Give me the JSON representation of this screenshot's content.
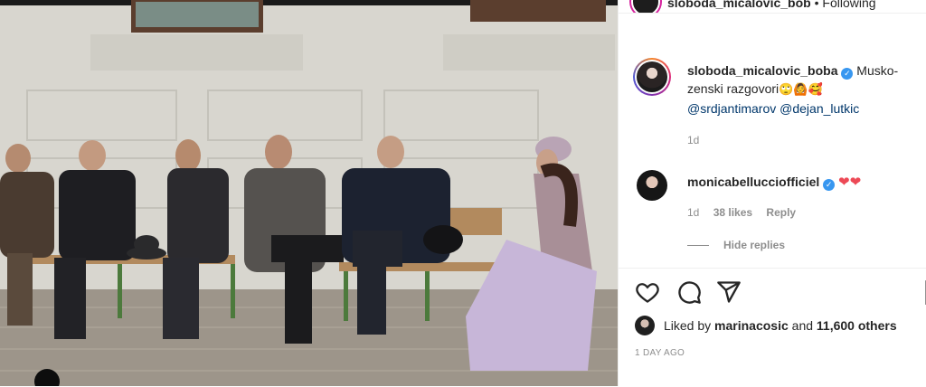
{
  "header": {
    "username": "sloboda_micalovic_bob",
    "separator": "•",
    "follow_state": "Following"
  },
  "caption": {
    "username": "sloboda_micalovic_boba",
    "text": "Musko-zenski razgovori",
    "emojis": "🙄🙆🥰",
    "mention1": "@srdjantimarov",
    "mention2": "@dejan_lutkic",
    "time": "1d"
  },
  "comment": {
    "username": "monicabellucciofficiel",
    "hearts": "❤❤",
    "time": "1d",
    "likes": "38 likes",
    "reply": "Reply"
  },
  "replies": {
    "label": "Hide replies"
  },
  "likes": {
    "prefix": "Liked by",
    "user": "marinacosic",
    "connector": "and",
    "others": "11,600 others"
  },
  "post_time": "1 DAY AGO",
  "icons": {
    "like": "heart-icon",
    "comment": "comment-icon",
    "share": "paper-plane-icon",
    "verified": "verified-badge-icon"
  },
  "colors": {
    "verified": "#3897f0",
    "heart": "#ed4956",
    "mention": "#00376b",
    "muted": "#8e8e8e"
  }
}
